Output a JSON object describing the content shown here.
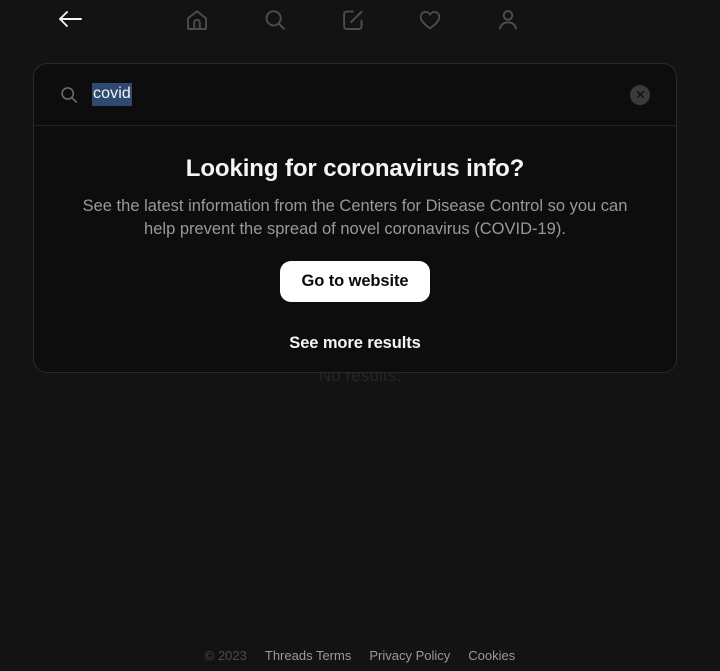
{
  "nav": {
    "back_label": "Back",
    "items": [
      {
        "name": "home-icon",
        "label": "Home"
      },
      {
        "name": "search-icon",
        "label": "Search"
      },
      {
        "name": "compose-icon",
        "label": "Create"
      },
      {
        "name": "heart-icon",
        "label": "Activity"
      },
      {
        "name": "profile-icon",
        "label": "Profile"
      }
    ]
  },
  "search": {
    "value": "covid",
    "placeholder": "Search",
    "icon": "search-icon",
    "clear_icon": "close-circle-icon",
    "selection_color": "#2f4a6e"
  },
  "results": {
    "empty_text": "No results."
  },
  "promo": {
    "title": "Looking for coronavirus info?",
    "description": "See the latest information from the Centers for Disease Control so you can help prevent the spread of novel coronavirus (COVID-19).",
    "cta_label": "Go to website",
    "see_more_label": "See more results"
  },
  "footer": {
    "copyright": "© 2023",
    "links": [
      {
        "label": "Threads Terms"
      },
      {
        "label": "Privacy Policy"
      },
      {
        "label": "Cookies"
      }
    ]
  },
  "colors": {
    "page_background": "#131313",
    "card_background": "#0d0d0d",
    "text_primary": "#f3f5f7",
    "text_secondary": "#999999",
    "cta_background": "#ffffff"
  }
}
